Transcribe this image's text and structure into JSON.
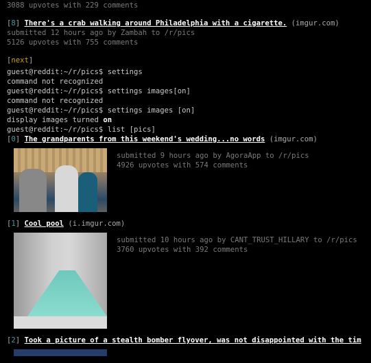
{
  "prev": {
    "stats": "3088 upvotes with 229 comments"
  },
  "post8": {
    "index": "8",
    "title": "There's a crab walking around Philadelphia with a cigarette.",
    "domain": "(imgur.com)",
    "submitted": "submitted 12 hours ago by Zambah to /r/pics",
    "stats": "5126 upvotes with 755 comments"
  },
  "next_label": "next",
  "session": [
    {
      "prompt": "guest@reddit:~/r/pics$ ",
      "cmd": "settings"
    },
    {
      "out": "command not recognized"
    },
    {
      "prompt": "guest@reddit:~/r/pics$ ",
      "cmd": "settings images[on]"
    },
    {
      "out": "command not recognized"
    },
    {
      "prompt": "guest@reddit:~/r/pics$ ",
      "cmd": "settings images [on]"
    },
    {
      "out": "display images turned ",
      "bold": "on"
    },
    {
      "prompt": "guest@reddit:~/r/pics$ ",
      "cmd": "list [pics]"
    }
  ],
  "posts": [
    {
      "index": "0",
      "title": "The grandparents from this weekend's wedding...no words",
      "domain": "(imgur.com)",
      "submitted": "submitted 9 hours ago by AgoraApp to /r/pics",
      "stats": "4926 upvotes with 574 comments"
    },
    {
      "index": "1",
      "title": "Cool pool",
      "domain": "(i.imgur.com)",
      "submitted": "submitted 10 hours ago by CANT_TRUST_HILLARY to /r/pics",
      "stats": "3760 upvotes with 392 comments"
    },
    {
      "index": "2",
      "title": "Took a picture of a stealth bomber flyover, was not disappointed with the tim"
    }
  ],
  "colors": {
    "background": "#000000",
    "index": "#3aa0a0",
    "next": "#c8a400",
    "meta": "#7a7a7a"
  }
}
